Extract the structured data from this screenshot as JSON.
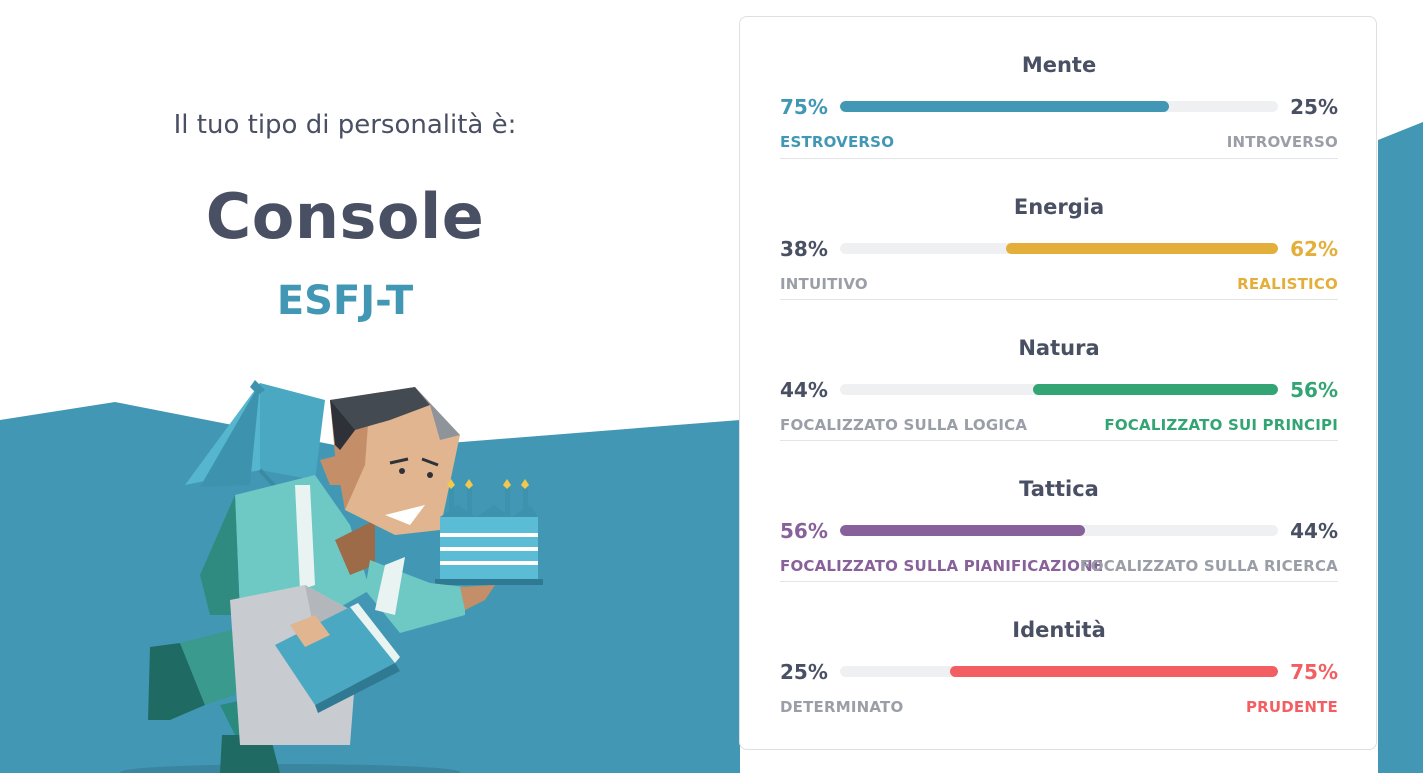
{
  "hero": {
    "intro": "Il tuo tipo di personalità è:",
    "type_name": "Console",
    "type_code": "ESFJ-T"
  },
  "traits": [
    {
      "title": "Mente",
      "left_pct": "75%",
      "right_pct": "25%",
      "left_label": "ESTROVERSO",
      "right_label": "INTROVERSO",
      "dominant": "left",
      "value": 0.75,
      "color": "#4298b4"
    },
    {
      "title": "Energia",
      "left_pct": "38%",
      "right_pct": "62%",
      "left_label": "INTUITIVO",
      "right_label": "REALISTICO",
      "dominant": "right",
      "value": 0.62,
      "color": "#e4ae3a"
    },
    {
      "title": "Natura",
      "left_pct": "44%",
      "right_pct": "56%",
      "left_label": "FOCALIZZATO SULLA LOGICA",
      "right_label": "FOCALIZZATO SUI PRINCIPI",
      "dominant": "right",
      "value": 0.56,
      "color": "#33a474"
    },
    {
      "title": "Tattica",
      "left_pct": "56%",
      "right_pct": "44%",
      "left_label": "FOCALIZZATO SULLA PIANIFICAZIONE",
      "right_label": "FOCALIZZATO SULLA RICERCA",
      "dominant": "left",
      "value": 0.56,
      "color": "#88619a"
    },
    {
      "title": "Identità",
      "left_pct": "25%",
      "right_pct": "75%",
      "left_label": "DETERMINATO",
      "right_label": "PRUDENTE",
      "dominant": "right",
      "value": 0.75,
      "color": "#f25e62"
    }
  ],
  "colors": {
    "wave": "#4298b4",
    "text": "#4a5063",
    "muted": "#9a9ea6",
    "track": "#eff0f2"
  }
}
